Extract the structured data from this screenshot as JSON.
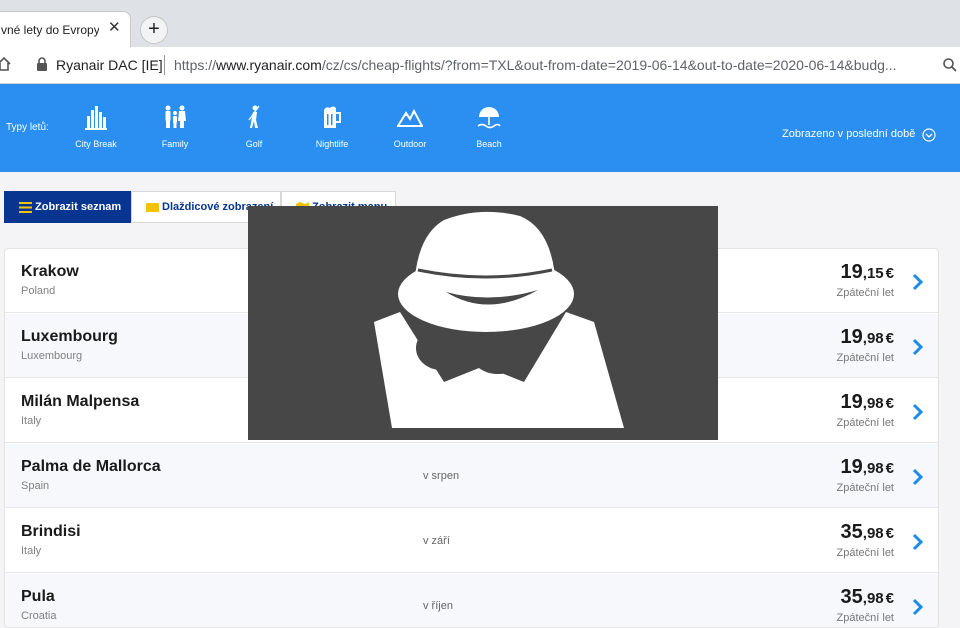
{
  "browser": {
    "tab_title": "vné lety do Evropy |",
    "tab_close": "✕",
    "new_tab": "+",
    "site_name": "Ryanair DAC [IE]",
    "url_prefix": "https://",
    "url_host": "www.ryanair.com",
    "url_path": "/cz/cs/cheap-flights/?from=TXL&out-from-date=2019-06-14&out-to-date=2020-06-14&budg..."
  },
  "categories": {
    "label": "Typy letů:",
    "items": [
      {
        "label": "City Break",
        "icon": "city-icon"
      },
      {
        "label": "Family",
        "icon": "family-icon"
      },
      {
        "label": "Golf",
        "icon": "golf-icon"
      },
      {
        "label": "Nightlife",
        "icon": "beer-icon"
      },
      {
        "label": "Outdoor",
        "icon": "mountain-icon"
      },
      {
        "label": "Beach",
        "icon": "umbrella-icon"
      }
    ],
    "recent": "Zobrazeno v poslední době"
  },
  "views": {
    "list": "Zobrazit seznam",
    "tiles": "Dlaždicové zobrazení",
    "map": "Zobrazit mapu"
  },
  "flights": [
    {
      "city": "Krakow",
      "country": "Poland",
      "month": "",
      "price_int": "19",
      "price_dec": ",15",
      "currency": "€",
      "type": "Zpáteční let"
    },
    {
      "city": "Luxembourg",
      "country": "Luxembourg",
      "month": "",
      "price_int": "19",
      "price_dec": ",98",
      "currency": "€",
      "type": "Zpáteční let"
    },
    {
      "city": "Milán Malpensa",
      "country": "Italy",
      "month": "",
      "price_int": "19",
      "price_dec": ",98",
      "currency": "€",
      "type": "Zpáteční let"
    },
    {
      "city": "Palma de Mallorca",
      "country": "Spain",
      "month": "v srpen",
      "price_int": "19",
      "price_dec": ",98",
      "currency": "€",
      "type": "Zpáteční let"
    },
    {
      "city": "Brindisi",
      "country": "Italy",
      "month": "v září",
      "price_int": "35",
      "price_dec": ",98",
      "currency": "€",
      "type": "Zpáteční let"
    },
    {
      "city": "Pula",
      "country": "Croatia",
      "month": "v říjen",
      "price_int": "35",
      "price_dec": ",98",
      "currency": "€",
      "type": "Zpáteční let"
    }
  ],
  "colors": {
    "brand_blue": "#2a8ff0",
    "dark_blue": "#073590",
    "chevron": "#1a8cec"
  },
  "overlay_icon": "incognito-icon"
}
